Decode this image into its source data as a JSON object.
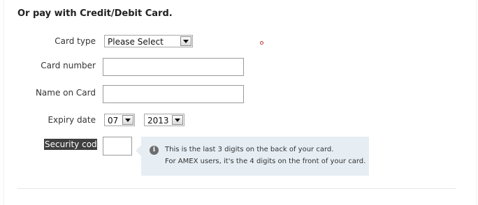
{
  "heading": "Or pay with Credit/Debit Card.",
  "fields": {
    "card_type": {
      "label": "Card type",
      "value": "Please Select"
    },
    "card_number": {
      "label": "Card number",
      "value": ""
    },
    "name_on_card": {
      "label": "Name on Card",
      "value": ""
    },
    "expiry": {
      "label": "Expiry date",
      "month": "07",
      "year": "2013"
    },
    "security_code": {
      "label": "Security code",
      "value": ""
    }
  },
  "tooltip": {
    "icon": "info-icon",
    "line1": "This is the last 3 digits on the back of your card.",
    "line2": "For AMEX users, it's the 4 digits on the front of your card."
  },
  "colors": {
    "required_dot": "#c0392b",
    "tooltip_bg": "#e6eef4",
    "security_label_bg": "#3f3f3f"
  }
}
